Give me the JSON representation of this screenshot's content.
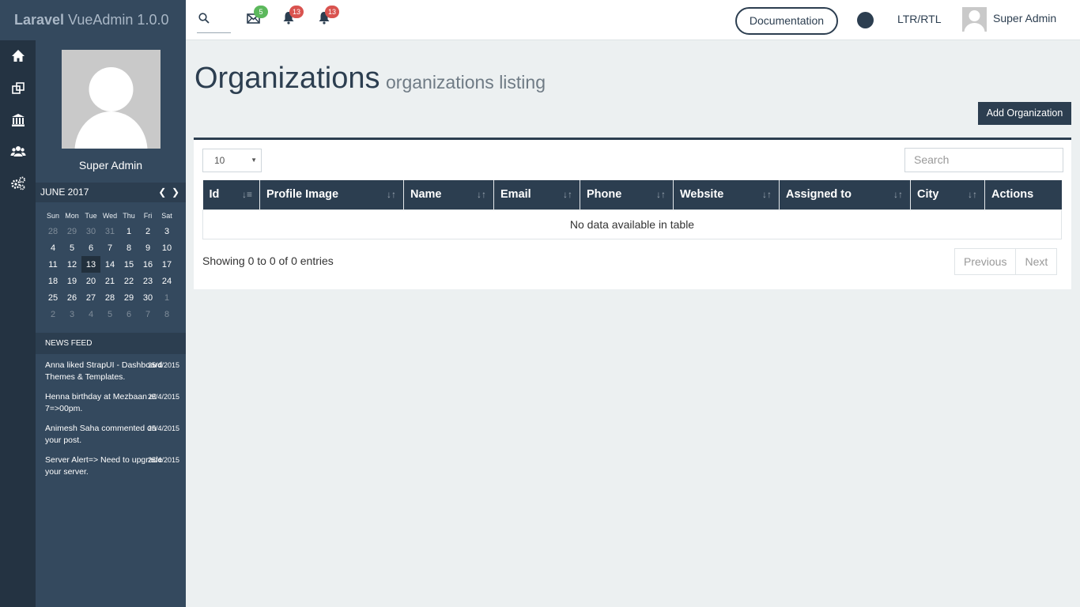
{
  "brand": {
    "bold": "Laravel",
    "rest": " VueAdmin 1.0.0"
  },
  "topbar": {
    "mail_badge": "5",
    "notif_badge_1": "13",
    "notif_badge_2": "13",
    "documentation_label": "Documentation",
    "direction_label": "LTR/RTL",
    "user_name": "Super Admin"
  },
  "panel": {
    "user_name": "Super Admin",
    "calendar": {
      "month": "JUNE 2017",
      "days": [
        "Sun",
        "Mon",
        "Tue",
        "Wed",
        "Thu",
        "Fri",
        "Sat"
      ],
      "weeks": [
        [
          "28",
          "29",
          "30",
          "31",
          "1",
          "2",
          "3"
        ],
        [
          "4",
          "5",
          "6",
          "7",
          "8",
          "9",
          "10"
        ],
        [
          "11",
          "12",
          "13",
          "14",
          "15",
          "16",
          "17"
        ],
        [
          "18",
          "19",
          "20",
          "21",
          "22",
          "23",
          "24"
        ],
        [
          "25",
          "26",
          "27",
          "28",
          "29",
          "30",
          "1"
        ],
        [
          "2",
          "3",
          "4",
          "5",
          "6",
          "7",
          "8"
        ]
      ]
    },
    "news_feed_title": "NEWS FEED",
    "news": [
      {
        "text": "Anna liked StrapUI - Dashboard Themes & Templates.",
        "date": "25/4/2015"
      },
      {
        "text": "Henna birthday at Mezbaan at 7=>00pm.",
        "date": "25/4/2015"
      },
      {
        "text": "Animesh Saha commented on your post.",
        "date": "25/4/2015"
      },
      {
        "text": "Server Alert=> Need to upgrade your server.",
        "date": "25/4/2015"
      }
    ]
  },
  "main": {
    "title": "Organizations",
    "subtitle": "organizations listing",
    "add_button": "Add Organization",
    "page_length": "10",
    "search_placeholder": "Search",
    "columns": [
      "Id",
      "Profile Image",
      "Name",
      "Email",
      "Phone",
      "Website",
      "Assigned to",
      "City",
      "Actions"
    ],
    "empty_text": "No data available in table",
    "info_text": "Showing 0 to 0 of 0 entries",
    "prev_label": "Previous",
    "next_label": "Next"
  },
  "icons": {
    "sidebar": [
      "home-icon",
      "copy-icon",
      "bank-icon",
      "users-icon",
      "cogs-icon"
    ]
  },
  "colors": {
    "dark": "#2c3e50",
    "sidebar": "#34495e",
    "iconbar": "#243342",
    "badge_green": "#5cb85c",
    "badge_red": "#d9534f"
  }
}
